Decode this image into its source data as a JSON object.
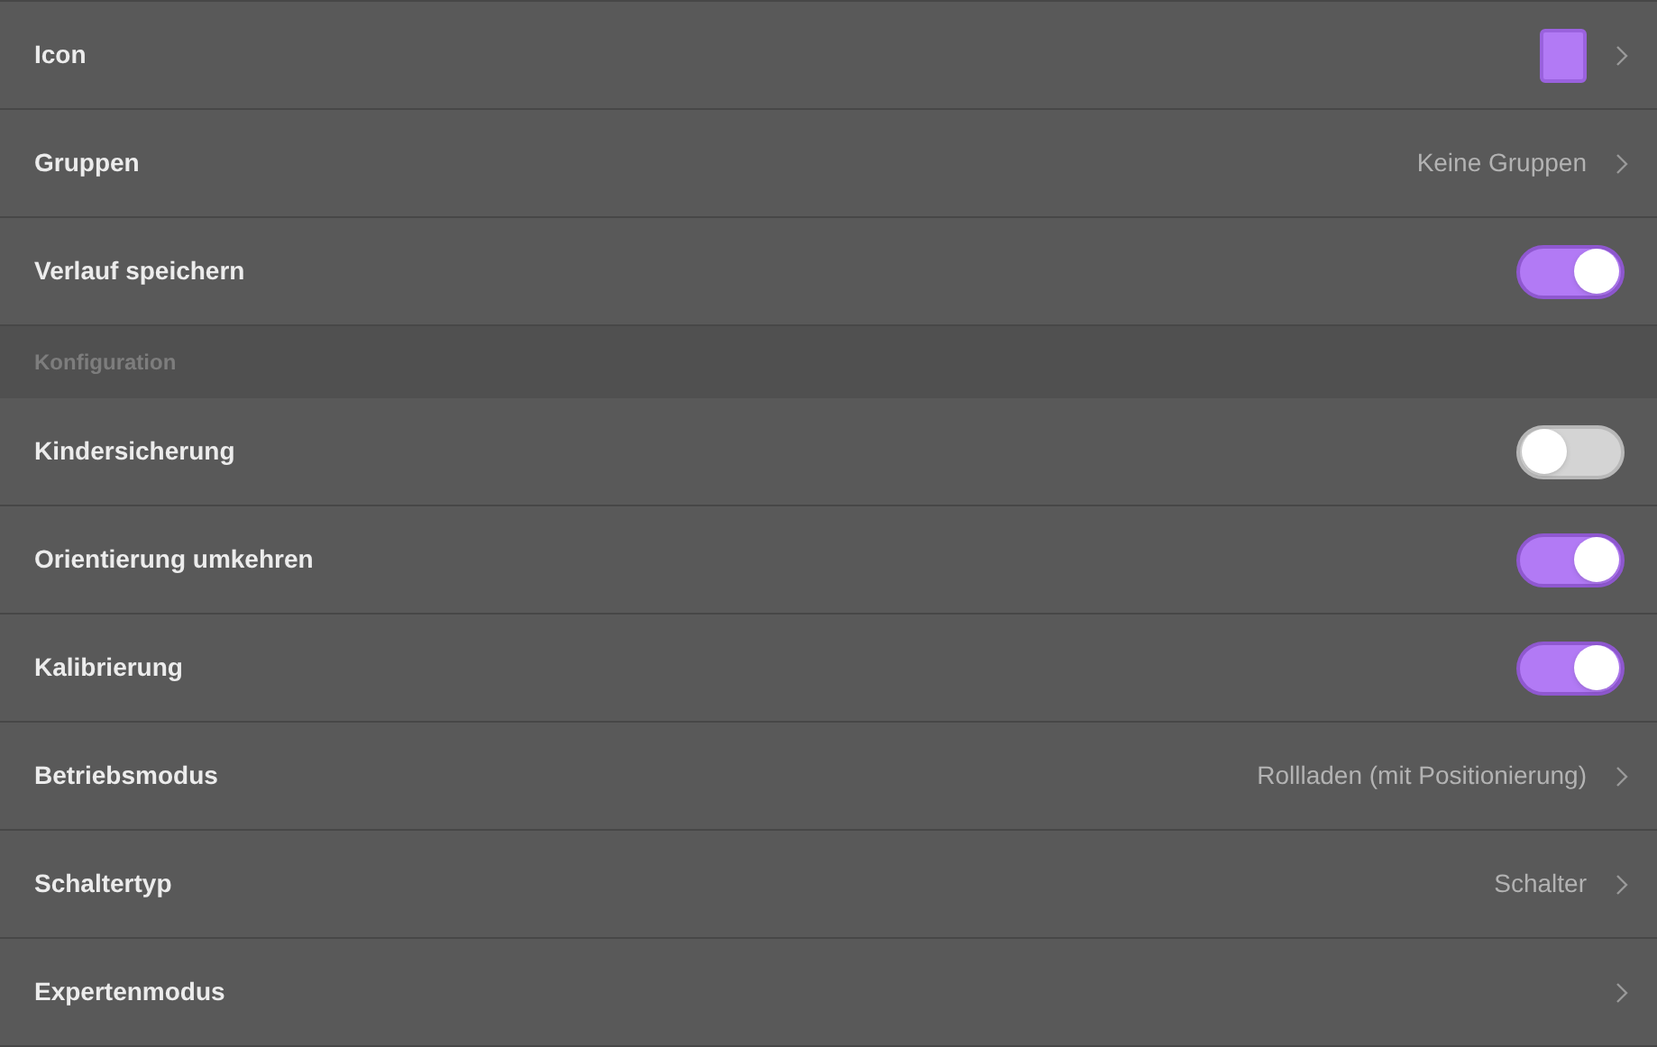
{
  "rows": [
    {
      "kind": "icon",
      "label": "Icon",
      "color": "#b27af5"
    },
    {
      "kind": "link",
      "label": "Gruppen",
      "value": "Keine Gruppen"
    },
    {
      "kind": "toggle",
      "label": "Verlauf speichern",
      "on": true
    },
    {
      "kind": "header",
      "label": "Konfiguration"
    },
    {
      "kind": "toggle",
      "label": "Kindersicherung",
      "on": false
    },
    {
      "kind": "toggle",
      "label": "Orientierung umkehren",
      "on": true
    },
    {
      "kind": "toggle",
      "label": "Kalibrierung",
      "on": true
    },
    {
      "kind": "link",
      "label": "Betriebsmodus",
      "value": "Rollladen (mit Positionierung)"
    },
    {
      "kind": "link",
      "label": "Schaltertyp",
      "value": "Schalter"
    },
    {
      "kind": "link",
      "label": "Expertenmodus"
    }
  ]
}
